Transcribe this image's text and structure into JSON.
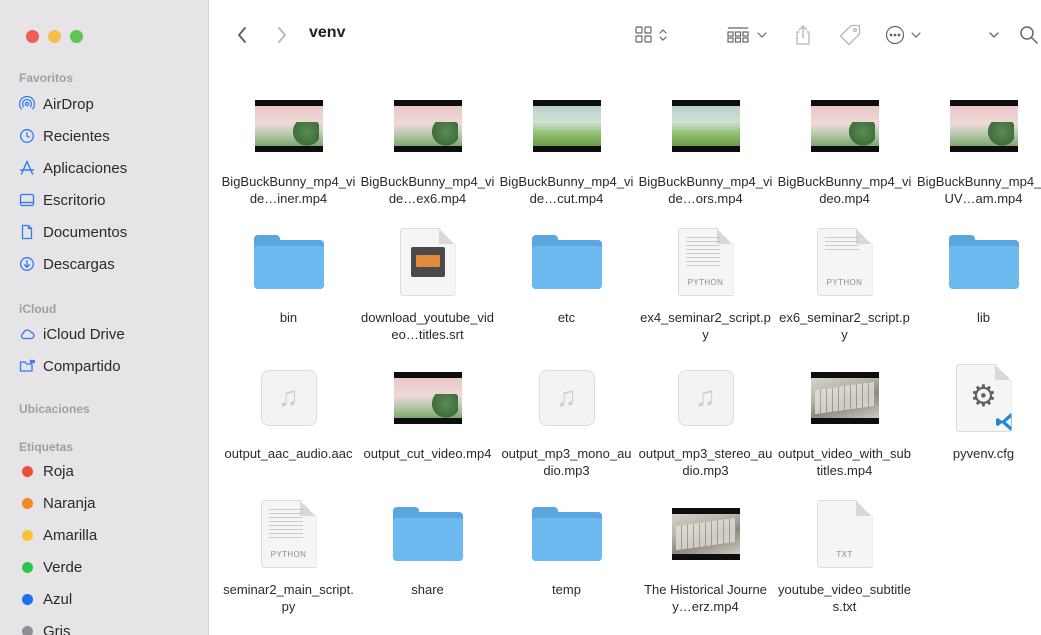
{
  "window": {
    "folder_title": "venv"
  },
  "sidebar": {
    "sections": [
      {
        "header": "Favoritos",
        "items": [
          {
            "label": "AirDrop",
            "icon": "airdrop-icon"
          },
          {
            "label": "Recientes",
            "icon": "clock-icon"
          },
          {
            "label": "Aplicaciones",
            "icon": "applications-icon"
          },
          {
            "label": "Escritorio",
            "icon": "desktop-icon"
          },
          {
            "label": "Documentos",
            "icon": "document-icon"
          },
          {
            "label": "Descargas",
            "icon": "download-icon"
          }
        ]
      },
      {
        "header": "iCloud",
        "items": [
          {
            "label": "iCloud Drive",
            "icon": "cloud-icon"
          },
          {
            "label": "Compartido",
            "icon": "shared-folder-icon"
          }
        ]
      },
      {
        "header": "Ubicaciones",
        "items": []
      },
      {
        "header": "Etiquetas",
        "items": [
          {
            "label": "Roja",
            "color": "#eb4e3d"
          },
          {
            "label": "Naranja",
            "color": "#f08a24"
          },
          {
            "label": "Amarilla",
            "color": "#f6c433"
          },
          {
            "label": "Verde",
            "color": "#2fc352"
          },
          {
            "label": "Azul",
            "color": "#1c6ef2"
          },
          {
            "label": "Gris",
            "color": "#8e8e93"
          }
        ]
      }
    ]
  },
  "files": [
    {
      "name": "BigBuckBunny_mp4_vide…iner.mp4",
      "kind": "video"
    },
    {
      "name": "BigBuckBunny_mp4_vide…ex6.mp4",
      "kind": "video"
    },
    {
      "name": "BigBuckBunny_mp4_vide…cut.mp4",
      "kind": "video-green"
    },
    {
      "name": "BigBuckBunny_mp4_vide…ors.mp4",
      "kind": "video-green"
    },
    {
      "name": "BigBuckBunny_mp4_video.mp4",
      "kind": "video"
    },
    {
      "name": "BigBuckBunny_mp4_YUV…am.mp4",
      "kind": "video"
    },
    {
      "name": "bin",
      "kind": "folder"
    },
    {
      "name": "download_youtube_video…titles.srt",
      "kind": "srt"
    },
    {
      "name": "etc",
      "kind": "folder"
    },
    {
      "name": "ex4_seminar2_script.py",
      "kind": "python",
      "badge": "PYTHON"
    },
    {
      "name": "ex6_seminar2_script.py",
      "kind": "python",
      "badge": "PYTHON"
    },
    {
      "name": "lib",
      "kind": "folder"
    },
    {
      "name": "output_aac_audio.aac",
      "kind": "audio"
    },
    {
      "name": "output_cut_video.mp4",
      "kind": "video"
    },
    {
      "name": "output_mp3_mono_audio.mp3",
      "kind": "audio"
    },
    {
      "name": "output_mp3_stereo_audio.mp3",
      "kind": "audio"
    },
    {
      "name": "output_video_with_subtitles.mp4",
      "kind": "video-keyboard"
    },
    {
      "name": "pyvenv.cfg",
      "kind": "cfg"
    },
    {
      "name": "seminar2_main_script.py",
      "kind": "python",
      "badge": "PYTHON"
    },
    {
      "name": "share",
      "kind": "folder"
    },
    {
      "name": "temp",
      "kind": "folder"
    },
    {
      "name": "The Historical Journey…erz.mp4",
      "kind": "video-keyboard"
    },
    {
      "name": "youtube_video_subtitles.txt",
      "kind": "text",
      "badge": "TXT"
    }
  ]
}
